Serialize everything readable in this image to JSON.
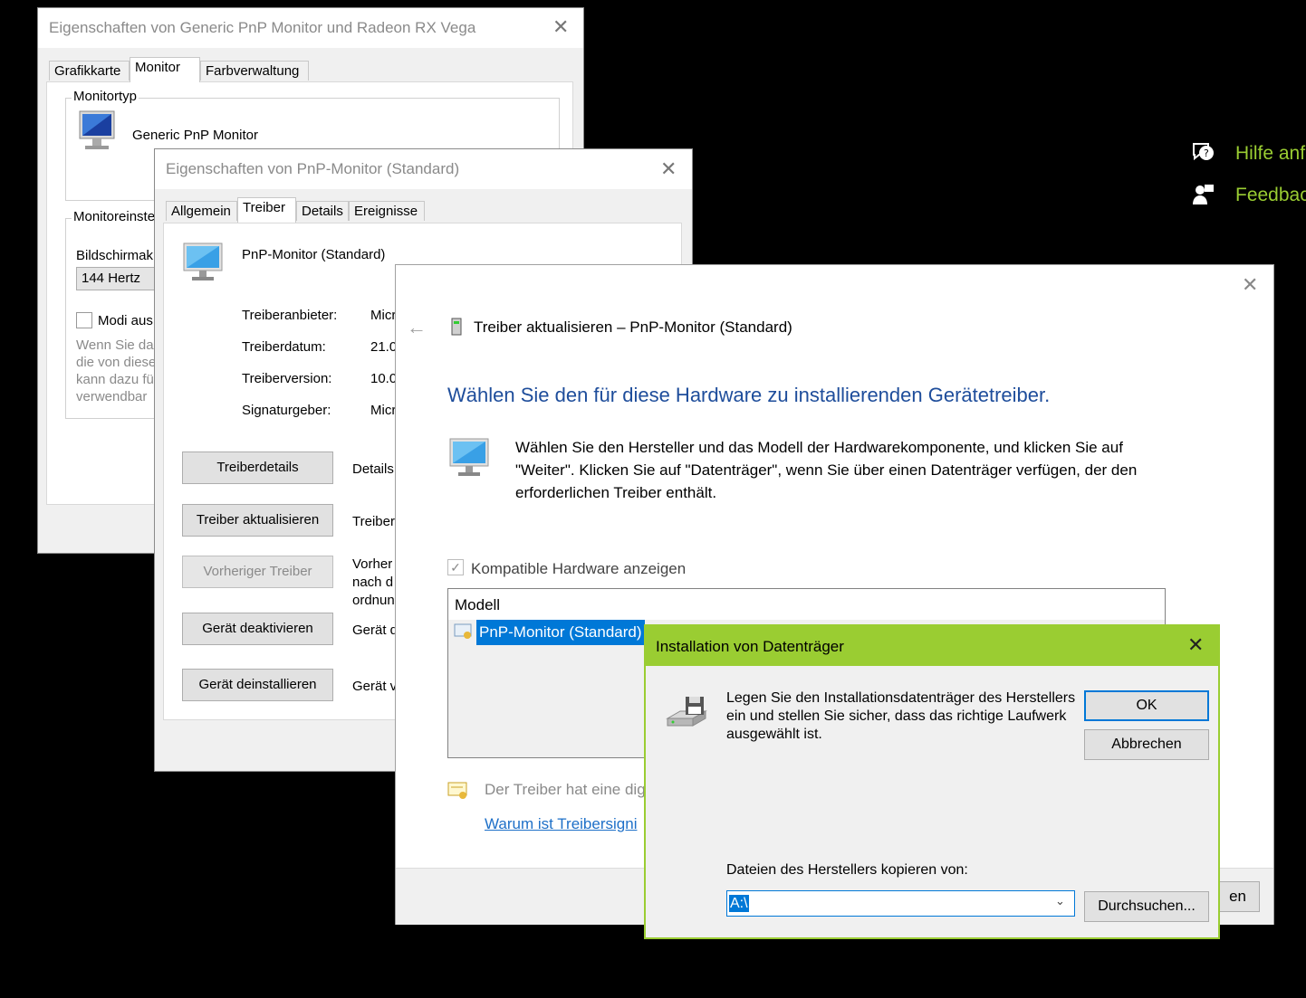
{
  "background_panel": {
    "help_label": "Hilfe anf",
    "feedback_label": "Feedbac",
    "accent_color": "#9acd32"
  },
  "win1": {
    "title": "Eigenschaften von Generic PnP Monitor und Radeon RX Vega",
    "tabs": [
      "Grafikkarte",
      "Monitor",
      "Farbverwaltung"
    ],
    "monitortyp_label": "Monitortyp",
    "monitor_name": "Generic PnP Monitor",
    "monitoreinst_label": "Monitoreinste",
    "bildschirm_label": "Bildschirmak",
    "refresh_value": "144 Hertz",
    "modi_label": "Modi aus",
    "desc_lines": [
      "Wenn Sie da",
      "die von diese",
      "kann dazu fü",
      "verwendbar"
    ]
  },
  "win2": {
    "title": "Eigenschaften von PnP-Monitor (Standard)",
    "tabs": [
      "Allgemein",
      "Treiber",
      "Details",
      "Ereignisse"
    ],
    "device_name": "PnP-Monitor (Standard)",
    "rows": [
      {
        "label": "Treiberanbieter:",
        "value": "Micr"
      },
      {
        "label": "Treiberdatum:",
        "value": "21.0"
      },
      {
        "label": "Treiberversion:",
        "value": "10.0"
      },
      {
        "label": "Signaturgeber:",
        "value": "Micr"
      }
    ],
    "buttons": [
      {
        "label": "Treiberdetails",
        "desc": [
          "Details"
        ]
      },
      {
        "label": "Treiber aktualisieren",
        "desc": [
          "Treiber"
        ]
      },
      {
        "label": "Vorheriger Treiber",
        "desc": [
          "Vorher",
          "nach d",
          "ordnun"
        ]
      },
      {
        "label": "Gerät deaktivieren",
        "desc": [
          "Gerät d"
        ]
      },
      {
        "label": "Gerät deinstallieren",
        "desc": [
          "Gerät v"
        ]
      }
    ]
  },
  "win3": {
    "header": "Treiber aktualisieren – PnP-Monitor (Standard)",
    "heading": "Wählen Sie den für diese Hardware zu installierenden Gerätetreiber.",
    "desc_lines": [
      "Wählen Sie den Hersteller und das Modell der Hardwarekomponente, und klicken Sie auf",
      "\"Weiter\". Klicken Sie auf \"Datenträger\", wenn Sie über einen Datenträger verfügen, der den",
      "erforderlichen Treiber enthält."
    ],
    "compatible_label": "Kompatible Hardware anzeigen",
    "list_header": "Modell",
    "list_item": "PnP-Monitor (Standard)",
    "signed_text": "Der Treiber hat eine dig",
    "link_text": "Warum ist Treibersigni",
    "partial_button": "en",
    "heading_color": "#1e4d9b"
  },
  "dialog": {
    "title": "Installation von Datenträger",
    "message_lines": [
      "Legen Sie den Installationsdatenträger des Herstellers",
      "ein und stellen Sie sicher, dass das richtige Laufwerk",
      "ausgewählt ist."
    ],
    "ok_label": "OK",
    "cancel_label": "Abbrechen",
    "copy_label": "Dateien des Herstellers kopieren von:",
    "path_value": "A:\\",
    "browse_label": "Durchsuchen...",
    "title_color": "#9acd32"
  }
}
